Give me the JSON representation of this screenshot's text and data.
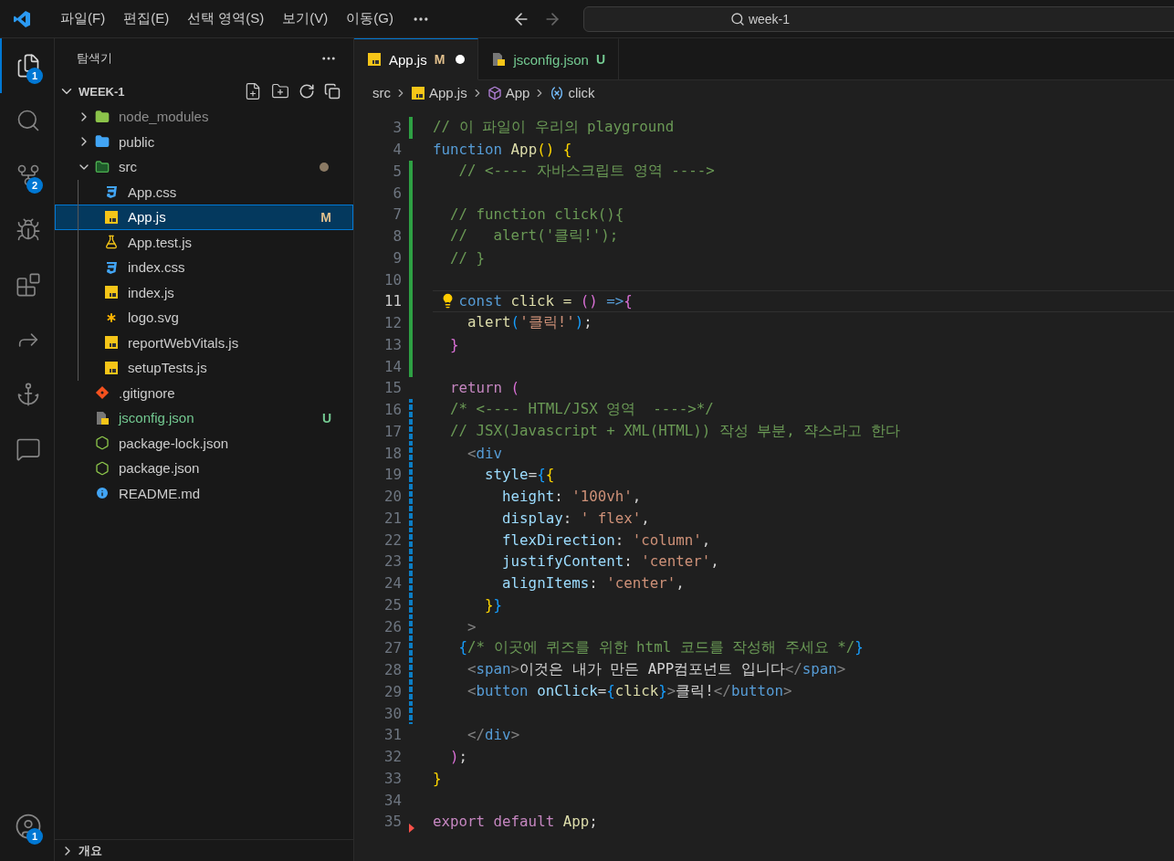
{
  "title_bar": {
    "menu": [
      "파일(F)",
      "편집(E)",
      "선택 영역(S)",
      "보기(V)",
      "이동(G)"
    ],
    "command_center": "week-1"
  },
  "activity_bar": [
    {
      "kind": "explorer",
      "selected": true,
      "badge": "1"
    },
    {
      "kind": "search",
      "selected": false
    },
    {
      "kind": "source-control",
      "selected": false,
      "badge": "2"
    },
    {
      "kind": "run-debug",
      "selected": false
    },
    {
      "kind": "extensions",
      "selected": false
    },
    {
      "kind": "remote",
      "selected": false
    },
    {
      "kind": "anchor",
      "selected": false
    },
    {
      "kind": "chat",
      "selected": false
    }
  ],
  "account": {
    "badge": "1"
  },
  "sidebar": {
    "title": "탐색기",
    "folder": "WEEK-1",
    "expanded": true,
    "tree": [
      {
        "name": "node_modules",
        "kind": "folder-node",
        "expanded": false,
        "ignored": true,
        "selected": false
      },
      {
        "name": "public",
        "kind": "folder-public",
        "expanded": false,
        "selected": false
      },
      {
        "name": "src",
        "kind": "folder-src",
        "expanded": true,
        "has_changes": true,
        "selected": false,
        "children": [
          {
            "name": "App.css",
            "kind": "css",
            "selected": false
          },
          {
            "name": "App.js",
            "kind": "js",
            "selected": true,
            "modified": true,
            "badge": "M"
          },
          {
            "name": "App.test.js",
            "kind": "test",
            "selected": false
          },
          {
            "name": "index.css",
            "kind": "css",
            "selected": false
          },
          {
            "name": "index.js",
            "kind": "js",
            "selected": false
          },
          {
            "name": "logo.svg",
            "kind": "svg",
            "selected": false
          },
          {
            "name": "reportWebVitals.js",
            "kind": "js",
            "selected": false
          },
          {
            "name": "setupTests.js",
            "kind": "js",
            "selected": false
          }
        ]
      },
      {
        "name": ".gitignore",
        "kind": "git",
        "selected": false
      },
      {
        "name": "jsconfig.json",
        "kind": "jsconfig",
        "untracked": true,
        "badge": "U",
        "selected": false
      },
      {
        "name": "package-lock.json",
        "kind": "node",
        "selected": false
      },
      {
        "name": "package.json",
        "kind": "node",
        "selected": false
      },
      {
        "name": "README.md",
        "kind": "info",
        "selected": false
      }
    ],
    "outline": {
      "title": "개요",
      "expanded": false
    }
  },
  "tabs": [
    {
      "label": "App.js",
      "kind": "js",
      "selected": true,
      "badge": "M",
      "modified": true,
      "dirty": true
    },
    {
      "label": "jsconfig.json",
      "kind": "jsconfig",
      "selected": false,
      "badge": "U",
      "untracked": true,
      "dirty": false
    }
  ],
  "breadcrumbs": [
    {
      "label": "src",
      "kind": "folder"
    },
    {
      "label": "App.js",
      "kind": "js"
    },
    {
      "label": "App",
      "kind": "component"
    },
    {
      "label": "click",
      "kind": "variable"
    }
  ],
  "editor": {
    "lines": [
      {
        "number": "3",
        "kind": "added",
        "tokens": [
          {
            "text": "// 이 파일이 우리의 playground",
            "kind": "comment"
          }
        ]
      },
      {
        "number": "4",
        "kind": "plain",
        "tokens": [
          {
            "text": "function ",
            "kind": "keyword"
          },
          {
            "text": "App",
            "kind": "function"
          },
          {
            "text": "() ",
            "kind": "bracket1"
          },
          {
            "text": "{",
            "kind": "bracket1"
          }
        ]
      },
      {
        "number": "5",
        "kind": "added",
        "tokens": [
          {
            "text": "   // <---- 자바스크립트 영역 ---->",
            "kind": "comment"
          }
        ]
      },
      {
        "number": "6",
        "kind": "added"
      },
      {
        "number": "7",
        "kind": "added",
        "tokens": [
          {
            "text": "  // function click(){",
            "kind": "comment"
          }
        ]
      },
      {
        "number": "8",
        "kind": "added",
        "tokens": [
          {
            "text": "  //   alert('클릭!');",
            "kind": "comment"
          }
        ]
      },
      {
        "number": "9",
        "kind": "added",
        "tokens": [
          {
            "text": "  // }",
            "kind": "comment"
          }
        ]
      },
      {
        "number": "10",
        "kind": "added"
      },
      {
        "number": "11",
        "kind": "added",
        "current": true,
        "lightbulb": true,
        "tokens": [
          {
            "text": "const ",
            "kind": "keyword"
          },
          {
            "text": "click = ",
            "kind": "function"
          },
          {
            "text": "() ",
            "kind": "bracket2"
          },
          {
            "text": "=>",
            "kind": "keyword"
          },
          {
            "text": "{",
            "kind": "bracket2"
          }
        ]
      },
      {
        "number": "12",
        "kind": "added",
        "tokens": [
          {
            "text": "    alert",
            "kind": "function"
          },
          {
            "text": "(",
            "kind": "bracket3"
          },
          {
            "text": "'클릭!'",
            "kind": "string"
          },
          {
            "text": ")",
            "kind": "bracket3"
          },
          {
            "text": ";",
            "kind": "plain"
          }
        ]
      },
      {
        "number": "13",
        "kind": "added",
        "tokens": [
          {
            "text": "  }",
            "kind": "bracket2"
          }
        ]
      },
      {
        "number": "14",
        "kind": "added"
      },
      {
        "number": "15",
        "kind": "plain",
        "tokens": [
          {
            "text": "  return ",
            "kind": "control"
          },
          {
            "text": "(",
            "kind": "bracket2"
          }
        ]
      },
      {
        "number": "16",
        "kind": "modified",
        "tokens": [
          {
            "text": "  /* <---- HTML/JSX 영역  ---->*/",
            "kind": "comment"
          }
        ]
      },
      {
        "number": "17",
        "kind": "modified",
        "tokens": [
          {
            "text": "  // JSX(Javascript + XML(HTML)) 작성 부분, 쟉스라고 한다",
            "kind": "comment"
          }
        ]
      },
      {
        "number": "18",
        "kind": "modified",
        "tokens": [
          {
            "text": "    <",
            "kind": "angle"
          },
          {
            "text": "div",
            "kind": "tag"
          }
        ]
      },
      {
        "number": "19",
        "kind": "modified",
        "tokens": [
          {
            "text": "      style",
            "kind": "attribute"
          },
          {
            "text": "=",
            "kind": "plain"
          },
          {
            "text": "{",
            "kind": "bracket3"
          },
          {
            "text": "{",
            "kind": "bracket1"
          }
        ]
      },
      {
        "number": "20",
        "kind": "modified",
        "tokens": [
          {
            "text": "        height",
            "kind": "attribute"
          },
          {
            "text": ": ",
            "kind": "plain"
          },
          {
            "text": "'100vh'",
            "kind": "string"
          },
          {
            "text": ",",
            "kind": "plain"
          }
        ]
      },
      {
        "number": "21",
        "kind": "modified",
        "tokens": [
          {
            "text": "        display",
            "kind": "attribute"
          },
          {
            "text": ": ",
            "kind": "plain"
          },
          {
            "text": "' flex'",
            "kind": "string"
          },
          {
            "text": ",",
            "kind": "plain"
          }
        ]
      },
      {
        "number": "22",
        "kind": "modified",
        "tokens": [
          {
            "text": "        flexDirection",
            "kind": "attribute"
          },
          {
            "text": ": ",
            "kind": "plain"
          },
          {
            "text": "'column'",
            "kind": "string"
          },
          {
            "text": ",",
            "kind": "plain"
          }
        ]
      },
      {
        "number": "23",
        "kind": "modified",
        "tokens": [
          {
            "text": "        justifyContent",
            "kind": "attribute"
          },
          {
            "text": ": ",
            "kind": "plain"
          },
          {
            "text": "'center'",
            "kind": "string"
          },
          {
            "text": ",",
            "kind": "plain"
          }
        ]
      },
      {
        "number": "24",
        "kind": "modified",
        "tokens": [
          {
            "text": "        alignItems",
            "kind": "attribute"
          },
          {
            "text": ": ",
            "kind": "plain"
          },
          {
            "text": "'center'",
            "kind": "string"
          },
          {
            "text": ",",
            "kind": "plain"
          }
        ]
      },
      {
        "number": "25",
        "kind": "modified",
        "tokens": [
          {
            "text": "      }",
            "kind": "bracket1"
          },
          {
            "text": "}",
            "kind": "bracket3"
          }
        ]
      },
      {
        "number": "26",
        "kind": "modified",
        "tokens": [
          {
            "text": "    >",
            "kind": "angle"
          }
        ]
      },
      {
        "number": "27",
        "kind": "modified",
        "tokens": [
          {
            "text": "   {",
            "kind": "bracket3"
          },
          {
            "text": "/* 이곳에 퀴즈를 위한 html 코드를 작성해 주세요 */",
            "kind": "comment"
          },
          {
            "text": "}",
            "kind": "bracket3"
          }
        ]
      },
      {
        "number": "28",
        "kind": "modified",
        "tokens": [
          {
            "text": "    <",
            "kind": "angle"
          },
          {
            "text": "span",
            "kind": "tag"
          },
          {
            "text": ">",
            "kind": "angle"
          },
          {
            "text": "이것은 내가 만든 APP컴포넌트 입니다",
            "kind": "plain"
          },
          {
            "text": "</",
            "kind": "angle"
          },
          {
            "text": "span",
            "kind": "tag"
          },
          {
            "text": ">",
            "kind": "angle"
          }
        ]
      },
      {
        "number": "29",
        "kind": "modified",
        "tokens": [
          {
            "text": "    <",
            "kind": "angle"
          },
          {
            "text": "button ",
            "kind": "tag"
          },
          {
            "text": "onClick",
            "kind": "attribute"
          },
          {
            "text": "=",
            "kind": "plain"
          },
          {
            "text": "{",
            "kind": "bracket3"
          },
          {
            "text": "click",
            "kind": "function"
          },
          {
            "text": "}",
            "kind": "bracket3"
          },
          {
            "text": ">",
            "kind": "angle"
          },
          {
            "text": "클릭!",
            "kind": "plain"
          },
          {
            "text": "</",
            "kind": "angle"
          },
          {
            "text": "button",
            "kind": "tag"
          },
          {
            "text": ">",
            "kind": "angle"
          }
        ]
      },
      {
        "number": "30",
        "kind": "modified"
      },
      {
        "number": "31",
        "kind": "plain",
        "tokens": [
          {
            "text": "    </",
            "kind": "angle"
          },
          {
            "text": "div",
            "kind": "tag"
          },
          {
            "text": ">",
            "kind": "angle"
          }
        ]
      },
      {
        "number": "32",
        "kind": "plain",
        "tokens": [
          {
            "text": "  )",
            "kind": "bracket2"
          },
          {
            "text": ";",
            "kind": "plain"
          }
        ]
      },
      {
        "number": "33",
        "kind": "plain",
        "tokens": [
          {
            "text": "}",
            "kind": "bracket1"
          }
        ]
      },
      {
        "number": "34",
        "kind": "plain"
      },
      {
        "number": "35",
        "kind": "deleted",
        "tokens": [
          {
            "text": "export default ",
            "kind": "control"
          },
          {
            "text": "App",
            "kind": "function"
          },
          {
            "text": ";",
            "kind": "plain"
          }
        ]
      }
    ]
  }
}
